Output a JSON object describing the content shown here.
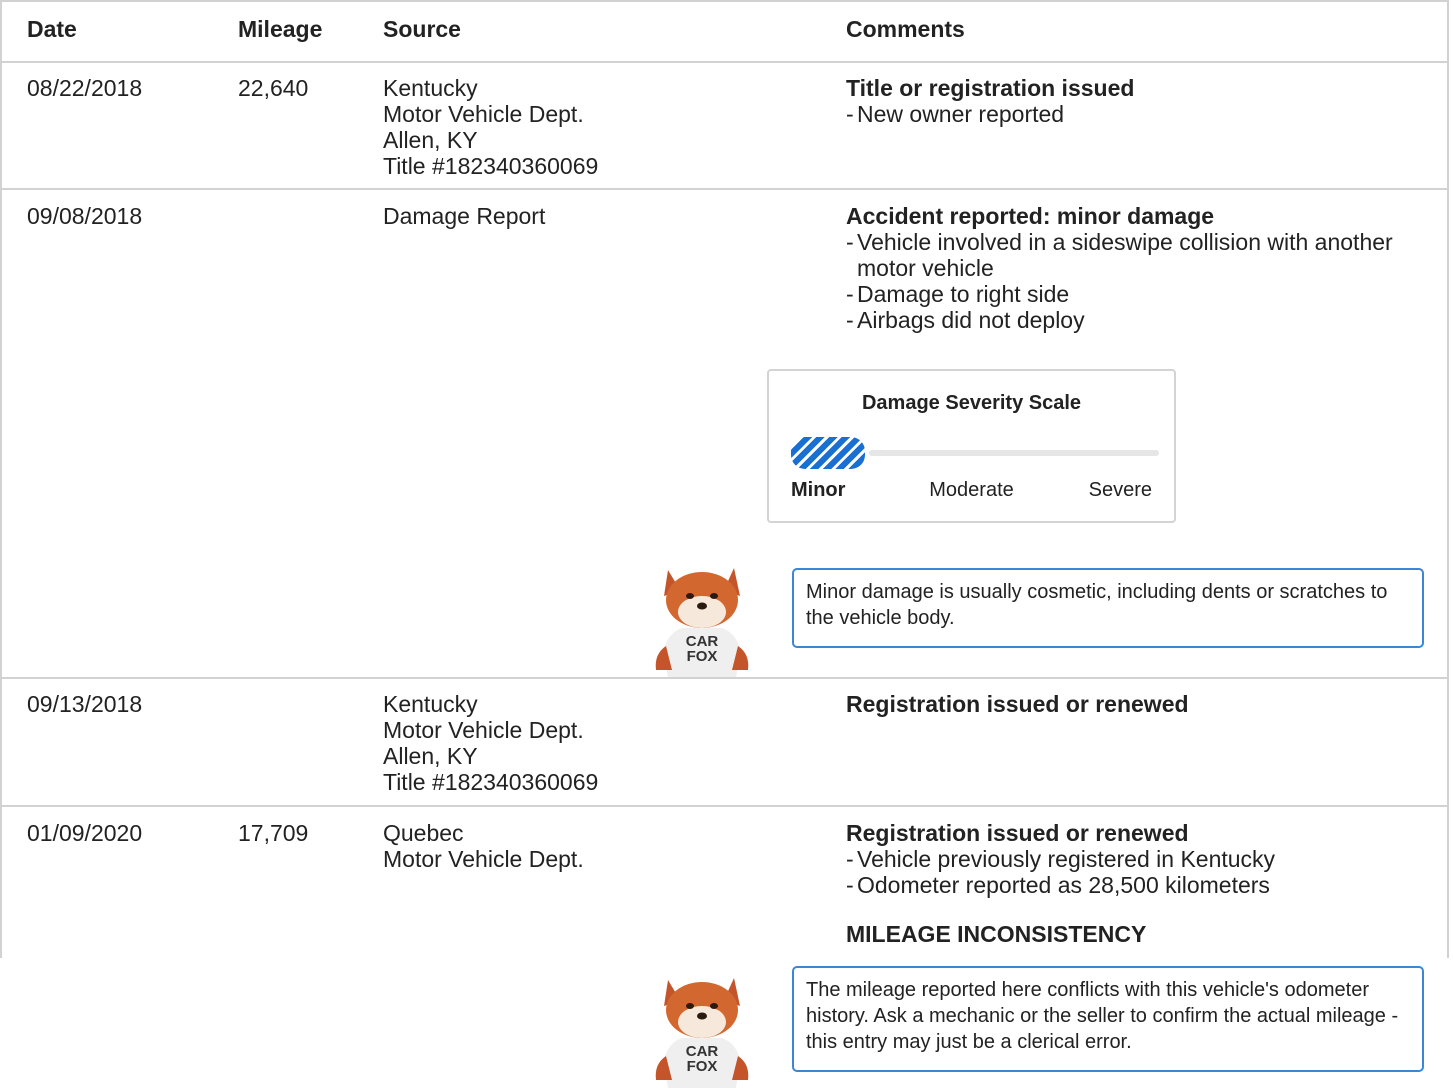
{
  "columns": {
    "date": "Date",
    "mileage": "Mileage",
    "source": "Source",
    "comments": "Comments"
  },
  "rows": [
    {
      "date": "08/22/2018",
      "mileage": "22,640",
      "source": [
        "Kentucky",
        "Motor Vehicle Dept.",
        "Allen, KY",
        "Title #182340360069"
      ],
      "heading": "Title or registration issued",
      "bullets": [
        "New owner reported"
      ]
    },
    {
      "date": "09/08/2018",
      "mileage": "",
      "source": [
        "Damage Report"
      ],
      "heading": "Accident reported: minor damage",
      "bullets": [
        "Vehicle involved in a sideswipe collision with another",
        "motor vehicle",
        "Damage to right side",
        "Airbags did not deploy"
      ],
      "severity": {
        "title": "Damage Severity Scale",
        "levels": [
          "Minor",
          "Moderate",
          "Severe"
        ],
        "selected": "Minor",
        "level_fraction": 0.2,
        "fill_color": "#1a6fd3"
      },
      "tip": "Minor damage is usually cosmetic, including dents or scratches to the vehicle body."
    },
    {
      "date": "09/13/2018",
      "mileage": "",
      "source": [
        "Kentucky",
        "Motor Vehicle Dept.",
        "Allen, KY",
        "Title #182340360069"
      ],
      "heading": "Registration issued or renewed",
      "bullets": []
    },
    {
      "date": "01/09/2020",
      "mileage": "17,709",
      "source": [
        "Quebec",
        "Motor Vehicle Dept."
      ],
      "heading": "Registration issued or renewed",
      "bullets": [
        "Vehicle previously registered in Kentucky",
        "Odometer reported as 28,500 kilometers"
      ],
      "alert": "MILEAGE INCONSISTENCY",
      "tip": "The mileage reported here conflicts with this vehicle's odometer history. Ask a mechanic or the seller to confirm the actual mileage - this entry may just be a clerical error."
    }
  ],
  "mascot": {
    "shirt_text_1": "CAR",
    "shirt_text_2": "FOX"
  },
  "colors": {
    "border": "#d2d2d2",
    "accent": "#3b86d6",
    "text": "#222222"
  }
}
